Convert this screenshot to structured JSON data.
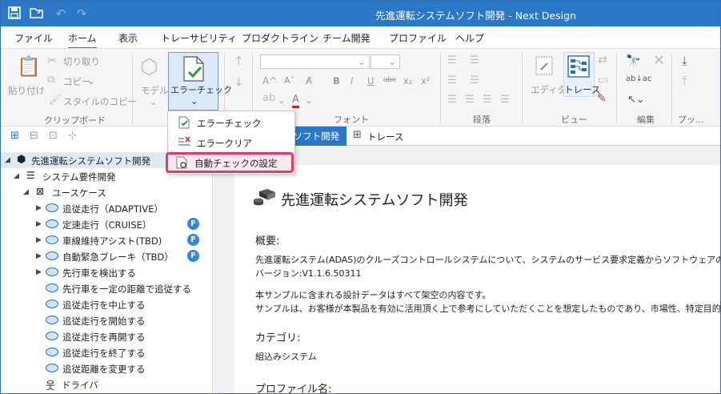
{
  "window": {
    "title": "先進運転システムソフト開発 - Next Design"
  },
  "menu": [
    "ファイル",
    "ホーム",
    "表示",
    "トレーサビリティ",
    "プロダクトライン",
    "チーム開発",
    "プロファイル",
    "ヘルプ"
  ],
  "ribbon": {
    "clipboard": {
      "paste": "貼り付け",
      "cut": "切り取り",
      "copy": "コピー",
      "copy_style": "スタイルのコピー",
      "label": "クリップボード"
    },
    "model": {
      "model": "モデル",
      "error_check": "エラーチェック"
    },
    "font": {
      "label": "フォント",
      "bold": "B",
      "italic": "I",
      "underline": "U",
      "strike": "abc",
      "sub": "x₂",
      "sup": "x²"
    },
    "paragraph": {
      "label": "段落"
    },
    "view": {
      "editor": "エディタ",
      "trace": "トレース",
      "label": "ビュー"
    },
    "edit": {
      "label": "編集"
    },
    "profile": {
      "label": "プッ..."
    }
  },
  "popup": {
    "items": [
      {
        "label": "エラーチェック",
        "icon": "error-check-icon"
      },
      {
        "label": "エラークリア",
        "icon": "error-clear-icon"
      },
      {
        "label": "自動チェックの設定",
        "icon": "auto-check-settings-icon"
      }
    ]
  },
  "tabs": [
    {
      "label": "先進運転システムソフト開発",
      "icon": "model-icon"
    },
    {
      "label": "トレース",
      "icon": "trace-icon"
    }
  ],
  "tree": {
    "root": "先進運転システムソフト開発",
    "req": "システム要件開発",
    "usecase": "ユースケース",
    "items": [
      {
        "label": "追従走行（ADAPTIVE）",
        "expand": true,
        "badge": ""
      },
      {
        "label": "定速走行（CRUISE）",
        "expand": true,
        "badge": "F"
      },
      {
        "label": "車線維持アシスト(TBD)",
        "expand": true,
        "badge": "F"
      },
      {
        "label": "自動緊急ブレーキ（TBD）",
        "expand": true,
        "badge": "F"
      },
      {
        "label": "先行車を検出する",
        "expand": true,
        "badge": ""
      },
      {
        "label": "先行車を一定の距離で追従する",
        "expand": false,
        "badge": ""
      },
      {
        "label": "追従走行を中止する",
        "expand": false,
        "badge": ""
      },
      {
        "label": "追従走行を開始する",
        "expand": false,
        "badge": ""
      },
      {
        "label": "追従走行を再開する",
        "expand": false,
        "badge": ""
      },
      {
        "label": "追従走行を終了する",
        "expand": false,
        "badge": ""
      },
      {
        "label": "追従距離を変更する",
        "expand": false,
        "badge": ""
      }
    ],
    "actor": "ドライバ"
  },
  "doc": {
    "title": "先進運転システムソフト開発",
    "overview_label": "概要:",
    "overview_line1": "先進運転システム(ADAS)のクルーズコントロールシステムについて、システムのサービス要求定義からソフトウェアの詳細設計ま",
    "overview_line2": "バージョン:V1.1.6.50311",
    "overview_line3": "本サンプルに含まれる設計データはすべて架空の内容です。",
    "overview_line4": "サンプルは、お客様が本製品を有効に活用頂く上で参考にしていただくことを想定したものであり、市場性、特定目的への適合",
    "category_label": "カテゴリ:",
    "category_value": "組込みシステム",
    "profile_label": "プロファイル名:"
  },
  "colors": {
    "accent": "#2b78c8",
    "highlight": "#e8386b",
    "badge": "#3b84d6"
  }
}
